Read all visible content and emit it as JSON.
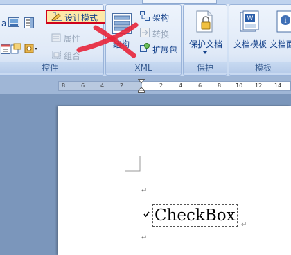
{
  "ribbon": {
    "groups": {
      "controls": {
        "label": "控件",
        "design_mode": "设计模式",
        "properties": "属性",
        "group": "组合",
        "aa_text": "a"
      },
      "xml": {
        "label": "XML",
        "structure": "结构",
        "schema": "架构",
        "transform": "转换",
        "expansion_pack": "扩展包"
      },
      "protect": {
        "label": "保护",
        "protect_document": "保护文档"
      },
      "templates": {
        "label": "模板",
        "document_template": "文档模板",
        "document_panel": "文档面"
      }
    },
    "colors": {
      "highlight_box": "#d0021b",
      "annotation_cross": "#e8253a"
    }
  },
  "ruler": {
    "ticks": [
      "8",
      "6",
      "4",
      "2",
      "2",
      "4",
      "6",
      "8",
      "10",
      "12",
      "14"
    ]
  },
  "document": {
    "paragraph_mark": "↵",
    "checkbox_label": "CheckBox"
  }
}
